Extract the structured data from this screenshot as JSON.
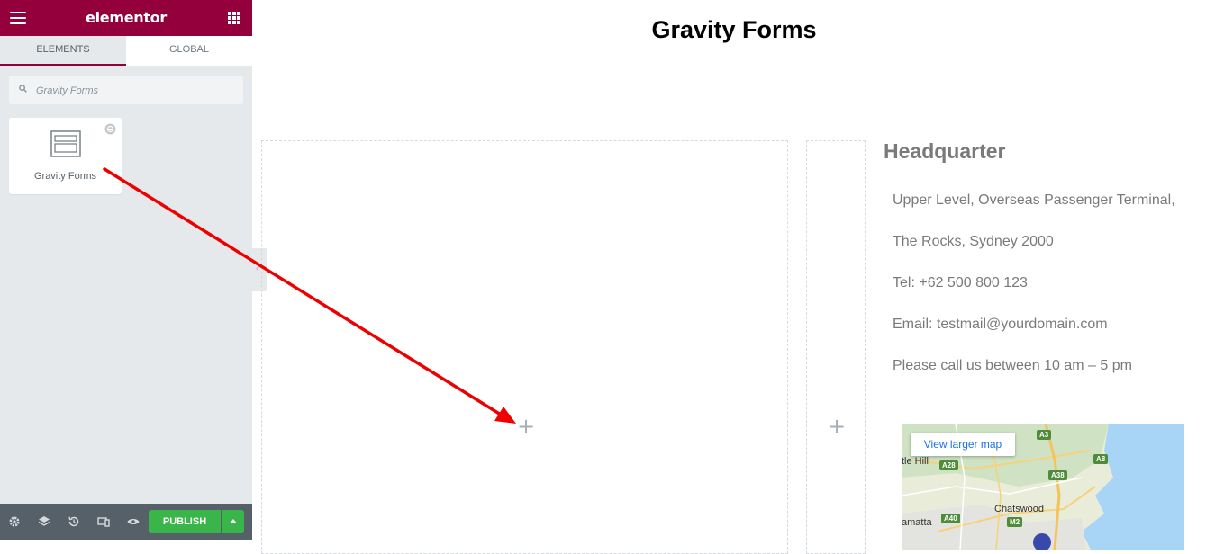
{
  "topbar": {
    "logo": "elementor"
  },
  "tabs": [
    {
      "label": "Elements"
    },
    {
      "label": "Global"
    }
  ],
  "search": {
    "placeholder": "Gravity Forms"
  },
  "widget": {
    "label": "Gravity Forms"
  },
  "footer": {
    "publish_label": "PUBLISH"
  },
  "page": {
    "title": "Gravity Forms",
    "headquarter": {
      "title": "Headquarter",
      "lines": [
        "Upper Level, Overseas Passenger Terminal,",
        "The Rocks, Sydney 2000",
        "Tel: +62 500 800 123",
        "Email: testmail@yourdomain.com",
        "Please call us between 10 am – 5 pm"
      ]
    },
    "map": {
      "link": "View larger map",
      "labels": [
        "tle Hill",
        "Chatswood",
        "amatta"
      ],
      "shields": [
        "A3",
        "A28",
        "A38",
        "A8",
        "A40",
        "M2"
      ]
    }
  },
  "colors": {
    "brand": "#93003c",
    "publish": "#39b54a",
    "arrow": "#ee0000"
  },
  "icons": {
    "menu": "hamburger-icon",
    "apps": "grid-icon",
    "search": "search-icon",
    "widget": "form-icon",
    "pro": "pro-badge-icon",
    "settings": "gear-icon",
    "navigator": "layers-icon",
    "history": "history-icon",
    "responsive": "responsive-icon",
    "preview": "eye-icon",
    "add": "plus-icon"
  }
}
